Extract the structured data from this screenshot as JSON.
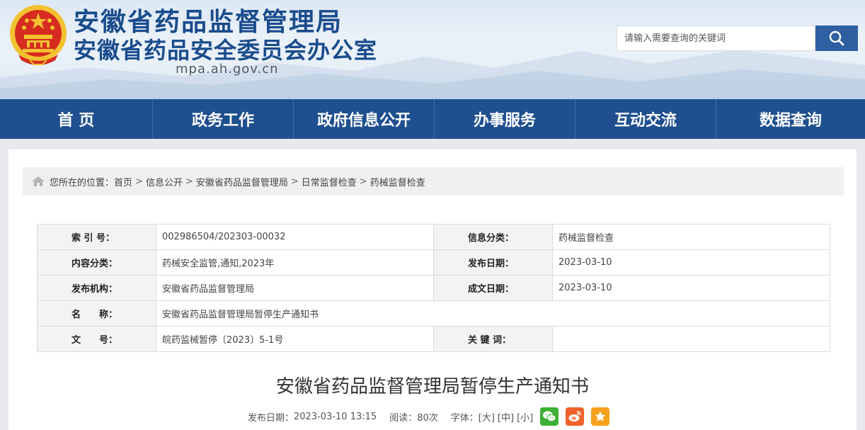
{
  "header": {
    "title_main": "安徽省药品监督管理局",
    "title_sub": "安徽省药品安全委员会办公室",
    "domain": "mpa.ah.gov.cn",
    "emblem_icon": "national-emblem-icon"
  },
  "search": {
    "placeholder": "请输入需要查询的关键词",
    "value": "",
    "button_icon": "search-icon"
  },
  "nav": {
    "items": [
      {
        "label": "首 页"
      },
      {
        "label": "政务工作"
      },
      {
        "label": "政府信息公开"
      },
      {
        "label": "办事服务"
      },
      {
        "label": "互动交流"
      },
      {
        "label": "数据查询"
      }
    ]
  },
  "breadcrumb": {
    "prefix": "您所在的位置：",
    "items": [
      "首页",
      "信息公开",
      "安徽省药品监督管理局",
      "日常监督检查",
      "药械监督检查"
    ],
    "separator": ">"
  },
  "meta": {
    "index_label": "索 引 号：",
    "index_value": "002986504/202303-00032",
    "category_label": "信息分类：",
    "category_value": "药械监督检查",
    "content_label": "内容分类：",
    "content_value": "药械安全监管,通知,2023年",
    "publish_date_label": "发布日期：",
    "publish_date_value": "2023-03-10",
    "org_label": "发布机构：",
    "org_value": "安徽省药品监督管理局",
    "created_date_label": "成文日期：",
    "created_date_value": "2023-03-10",
    "name_label": "名　　称：",
    "name_value": "安徽省药品监督管理局暂停生产通知书",
    "doc_no_label": "文　　号：",
    "doc_no_value": "皖药监械暂停〔2023〕5-1号",
    "keywords_label": "关 键 词：",
    "keywords_value": ""
  },
  "article": {
    "title": "安徽省药品监督管理局暂停生产通知书",
    "publish_label": "发布日期：",
    "publish_datetime": "2023-03-10 13:15",
    "reads_label": "阅读：",
    "reads_value": "80次",
    "font_label": "字体：",
    "font_large": "[大]",
    "font_medium": "[中]",
    "font_small": "[小]"
  },
  "share": {
    "wechat_icon": "wechat-icon",
    "weibo_icon": "weibo-icon",
    "favorite_icon": "star-icon",
    "wechat_color": "#3cb034",
    "weibo_color": "#f0622c",
    "favorite_color": "#f7a11c"
  },
  "colors": {
    "brand_blue": "#1f4f8f",
    "title_blue": "#1a4c8c",
    "emblem_red": "#d62b1f",
    "emblem_gold": "#f2c230"
  }
}
